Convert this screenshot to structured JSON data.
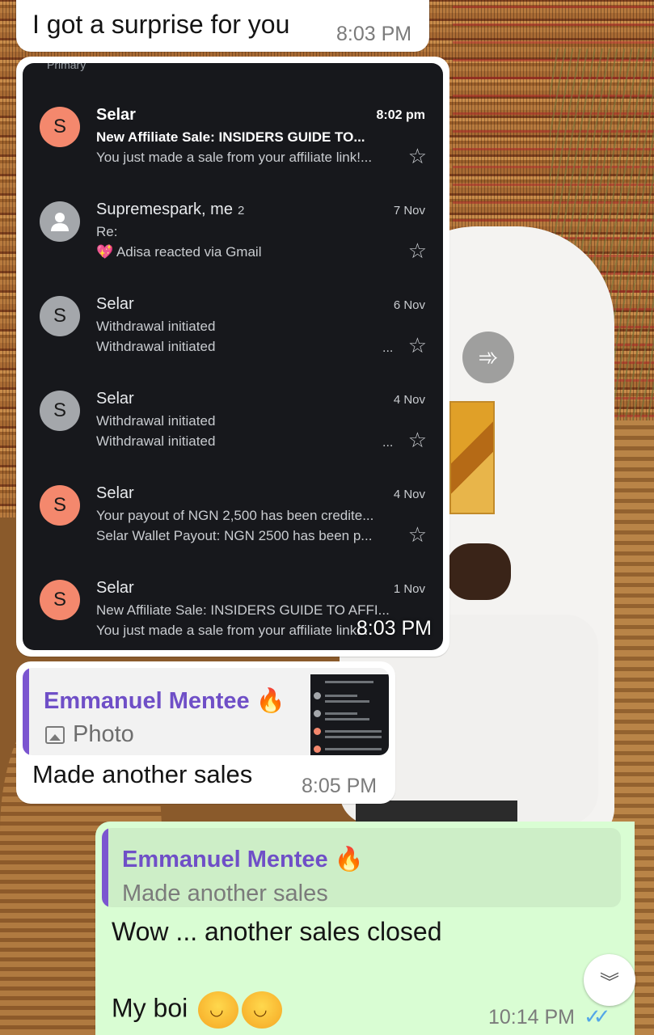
{
  "messages": [
    {
      "type": "text",
      "direction": "incoming",
      "text": "I got a surprise for you",
      "time": "8:03 PM"
    },
    {
      "type": "image",
      "direction": "incoming",
      "time": "8:03 PM",
      "screenshot": {
        "top_label": "Primary",
        "emails": [
          {
            "avatar": "S",
            "avatar_color": "#f4886d",
            "sender": "Selar",
            "date": "8:02 pm",
            "unread": true,
            "subject": "New Affiliate Sale: INSIDERS GUIDE TO...",
            "snippet": "You just made a sale from your affiliate link!..."
          },
          {
            "avatar": "person-icon",
            "avatar_color": "#a4a7ab",
            "sender": "Supremespark, me",
            "thread_count": "2",
            "date": "7 Nov",
            "unread": false,
            "subject": "Re:",
            "snippet": "💖 Adisa reacted via Gmail"
          },
          {
            "avatar": "S",
            "avatar_color": "#a4a7ab",
            "sender": "Selar",
            "date": "6 Nov",
            "unread": false,
            "subject": "Withdrawal initiated",
            "snippet": "Withdrawal initiated",
            "ellipsis": "..."
          },
          {
            "avatar": "S",
            "avatar_color": "#a4a7ab",
            "sender": "Selar",
            "date": "4 Nov",
            "unread": false,
            "subject": "Withdrawal initiated",
            "snippet": "Withdrawal initiated",
            "ellipsis": "..."
          },
          {
            "avatar": "S",
            "avatar_color": "#f4886d",
            "sender": "Selar",
            "date": "4 Nov",
            "unread": false,
            "subject": "Your payout of NGN 2,500 has been credite...",
            "snippet": "Selar Wallet Payout: NGN 2500 has been p..."
          },
          {
            "avatar": "S",
            "avatar_color": "#f4886d",
            "sender": "Selar",
            "date": "1 Nov",
            "unread": false,
            "subject": "New Affiliate Sale: INSIDERS GUIDE TO AFFI...",
            "snippet": "You just made a sale from your affiliate link!..."
          }
        ]
      }
    },
    {
      "type": "reply",
      "direction": "incoming",
      "quote": {
        "author": "Emmanuel Mentee 🔥",
        "text": "Photo",
        "icon": "photo-icon"
      },
      "text": "Made another sales",
      "time": "8:05 PM"
    },
    {
      "type": "reply",
      "direction": "outgoing",
      "quote": {
        "author": "Emmanuel Mentee 🔥",
        "text": "Made another sales"
      },
      "line1": "Wow ... another sales closed",
      "line2": "My boi",
      "emoji": "🤗🤗",
      "time": "10:14 PM",
      "status": "read"
    }
  ],
  "icons": {
    "forward": "forward-icon",
    "scroll_down": "chevron-double-down-icon"
  },
  "colors": {
    "outgoing_bubble": "#d9fdd3",
    "quote_author": "#6f4fc7",
    "read_ticks": "#53a6e7"
  }
}
